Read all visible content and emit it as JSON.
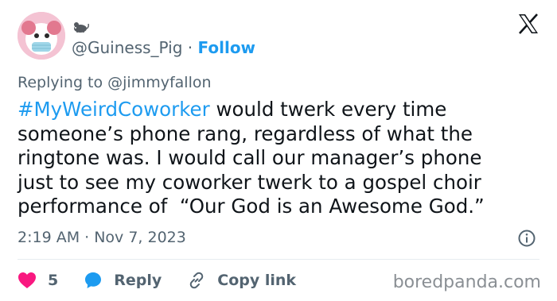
{
  "author": {
    "handle": "@Guiness_Pig",
    "separator": " · ",
    "follow_label": "Follow"
  },
  "replying_to": {
    "prefix": "Replying to ",
    "mention": "@jimmyfallon"
  },
  "body": {
    "hashtag": "#MyWeirdCoworker",
    "line1_rest": " would twerk every time",
    "line2": "someone’s phone rang, regardless of what the",
    "line3": "ringtone was. I would call our manager’s phone",
    "line4": "just to see my coworker twerk to a gospel choir",
    "line5": "performance of  “Our God is an Awesome God.”"
  },
  "timestamp": "2:19 AM · Nov 7, 2023",
  "actions": {
    "like_count": "5",
    "reply_label": "Reply",
    "copy_link_label": "Copy link"
  },
  "watermark": "boredpanda.com",
  "colors": {
    "link_blue": "#1d9bf0",
    "heart_red": "#f91880",
    "secondary_text": "#536471"
  },
  "icons": [
    "avatar",
    "mouse-icon",
    "x-logo-icon",
    "info-icon",
    "heart-icon",
    "reply-bubble-icon",
    "link-icon"
  ]
}
